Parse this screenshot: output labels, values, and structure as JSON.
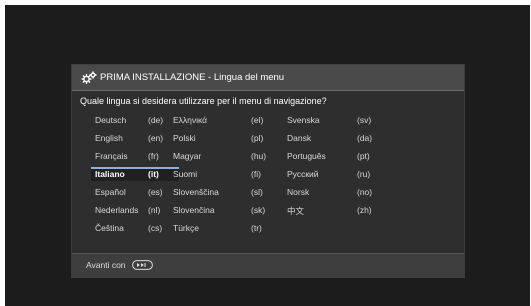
{
  "dialog": {
    "title": "PRIMA INSTALLAZIONE - Lingua del menu",
    "question": "Quale lingua si desidera utilizzare per il menu di navigazione?",
    "title_icon": "settings-gear-icon"
  },
  "languages": [
    {
      "name": "Deutsch",
      "code": "(de)"
    },
    {
      "name": "English",
      "code": "(en)"
    },
    {
      "name": "Français",
      "code": "(fr)"
    },
    {
      "name": "Italiano",
      "code": "(it)"
    },
    {
      "name": "Español",
      "code": "(es)"
    },
    {
      "name": "Nederlands",
      "code": "(nl)"
    },
    {
      "name": "Čeština",
      "code": "(cs)"
    },
    {
      "name": "Ελληνικά",
      "code": "(el)"
    },
    {
      "name": "Polski",
      "code": "(pl)"
    },
    {
      "name": "Magyar",
      "code": "(hu)"
    },
    {
      "name": "Suomi",
      "code": "(fi)"
    },
    {
      "name": "Slovenščina",
      "code": "(sl)"
    },
    {
      "name": "Slovenčina",
      "code": "(sk)"
    },
    {
      "name": "Türkçe",
      "code": "(tr)"
    },
    {
      "name": "Svenska",
      "code": "(sv)"
    },
    {
      "name": "Dansk",
      "code": "(da)"
    },
    {
      "name": "Português",
      "code": "(pt)"
    },
    {
      "name": "Русский",
      "code": "(ru)"
    },
    {
      "name": "Norsk",
      "code": "(no)"
    },
    {
      "name": "中文",
      "code": "(zh)"
    }
  ],
  "selected_language": "Italiano",
  "footer": {
    "label": "Avanti con",
    "button_icon": "ok-button-icon"
  },
  "colors": {
    "background": "#1c1c1c",
    "dialog": "#2e2e2e",
    "title_bar": "#4a4a4a",
    "selection_accent": "#8ab0e0"
  }
}
